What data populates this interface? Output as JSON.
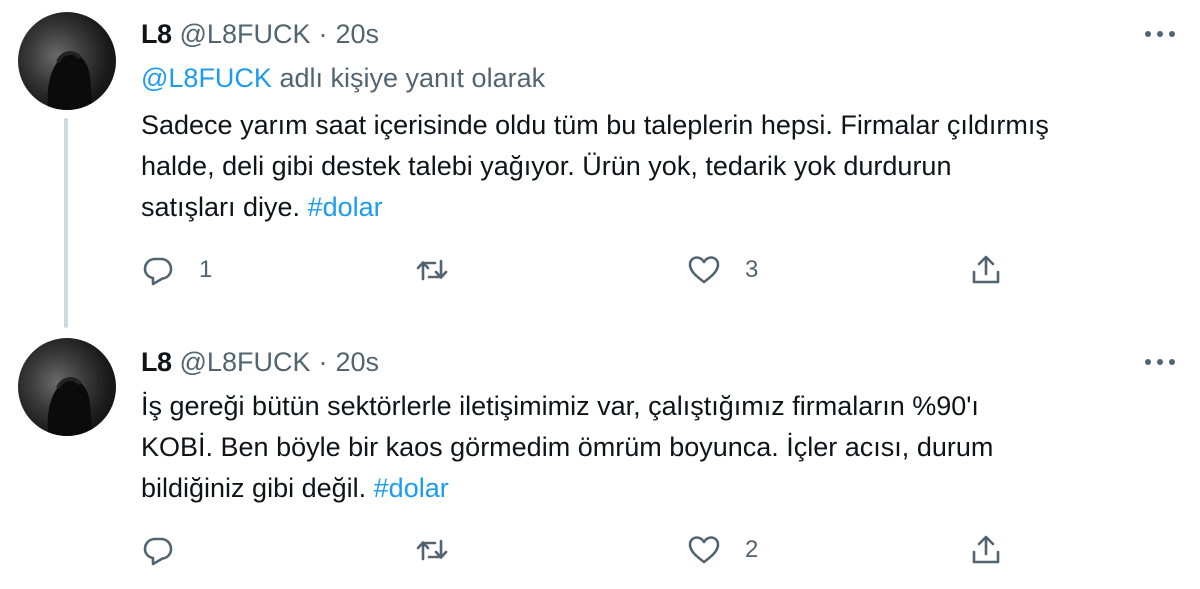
{
  "tweets": [
    {
      "display_name": "L8",
      "handle": "@L8FUCK",
      "separator": "·",
      "time": "20s",
      "reply_prefix_mention": "@L8FUCK",
      "reply_suffix": "adlı kişiye yanıt olarak",
      "body_lines": [
        "Sadece yarım saat içerisinde oldu tüm bu taleplerin hepsi. Firmalar çıldırmış",
        "halde, deli gibi destek talebi yağıyor. Ürün yok, tedarik yok durdurun",
        "satışları diye."
      ],
      "hashtag": "#dolar",
      "reply_count": "1",
      "retweet_count": "",
      "like_count": "3"
    },
    {
      "display_name": "L8",
      "handle": "@L8FUCK",
      "separator": "·",
      "time": "20s",
      "body_lines": [
        "İş gereği bütün sektörlerle iletişimimiz var, çalıştığımız firmaların %90'ı",
        "KOBİ. Ben böyle bir kaos görmedim ömrüm boyunca. İçler acısı, durum",
        "bildiğiniz gibi değil."
      ],
      "hashtag": "#dolar",
      "reply_count": "",
      "retweet_count": "",
      "like_count": "2"
    }
  ],
  "icons": {
    "more": "more-horizontal-icon",
    "reply": "reply-bubble-icon",
    "retweet": "retweet-icon",
    "like": "heart-icon",
    "share": "share-upload-icon"
  },
  "colors": {
    "text": "#0f1419",
    "secondary": "#536471",
    "accent": "#1d9bf0",
    "thread_line": "#cfd9de"
  }
}
